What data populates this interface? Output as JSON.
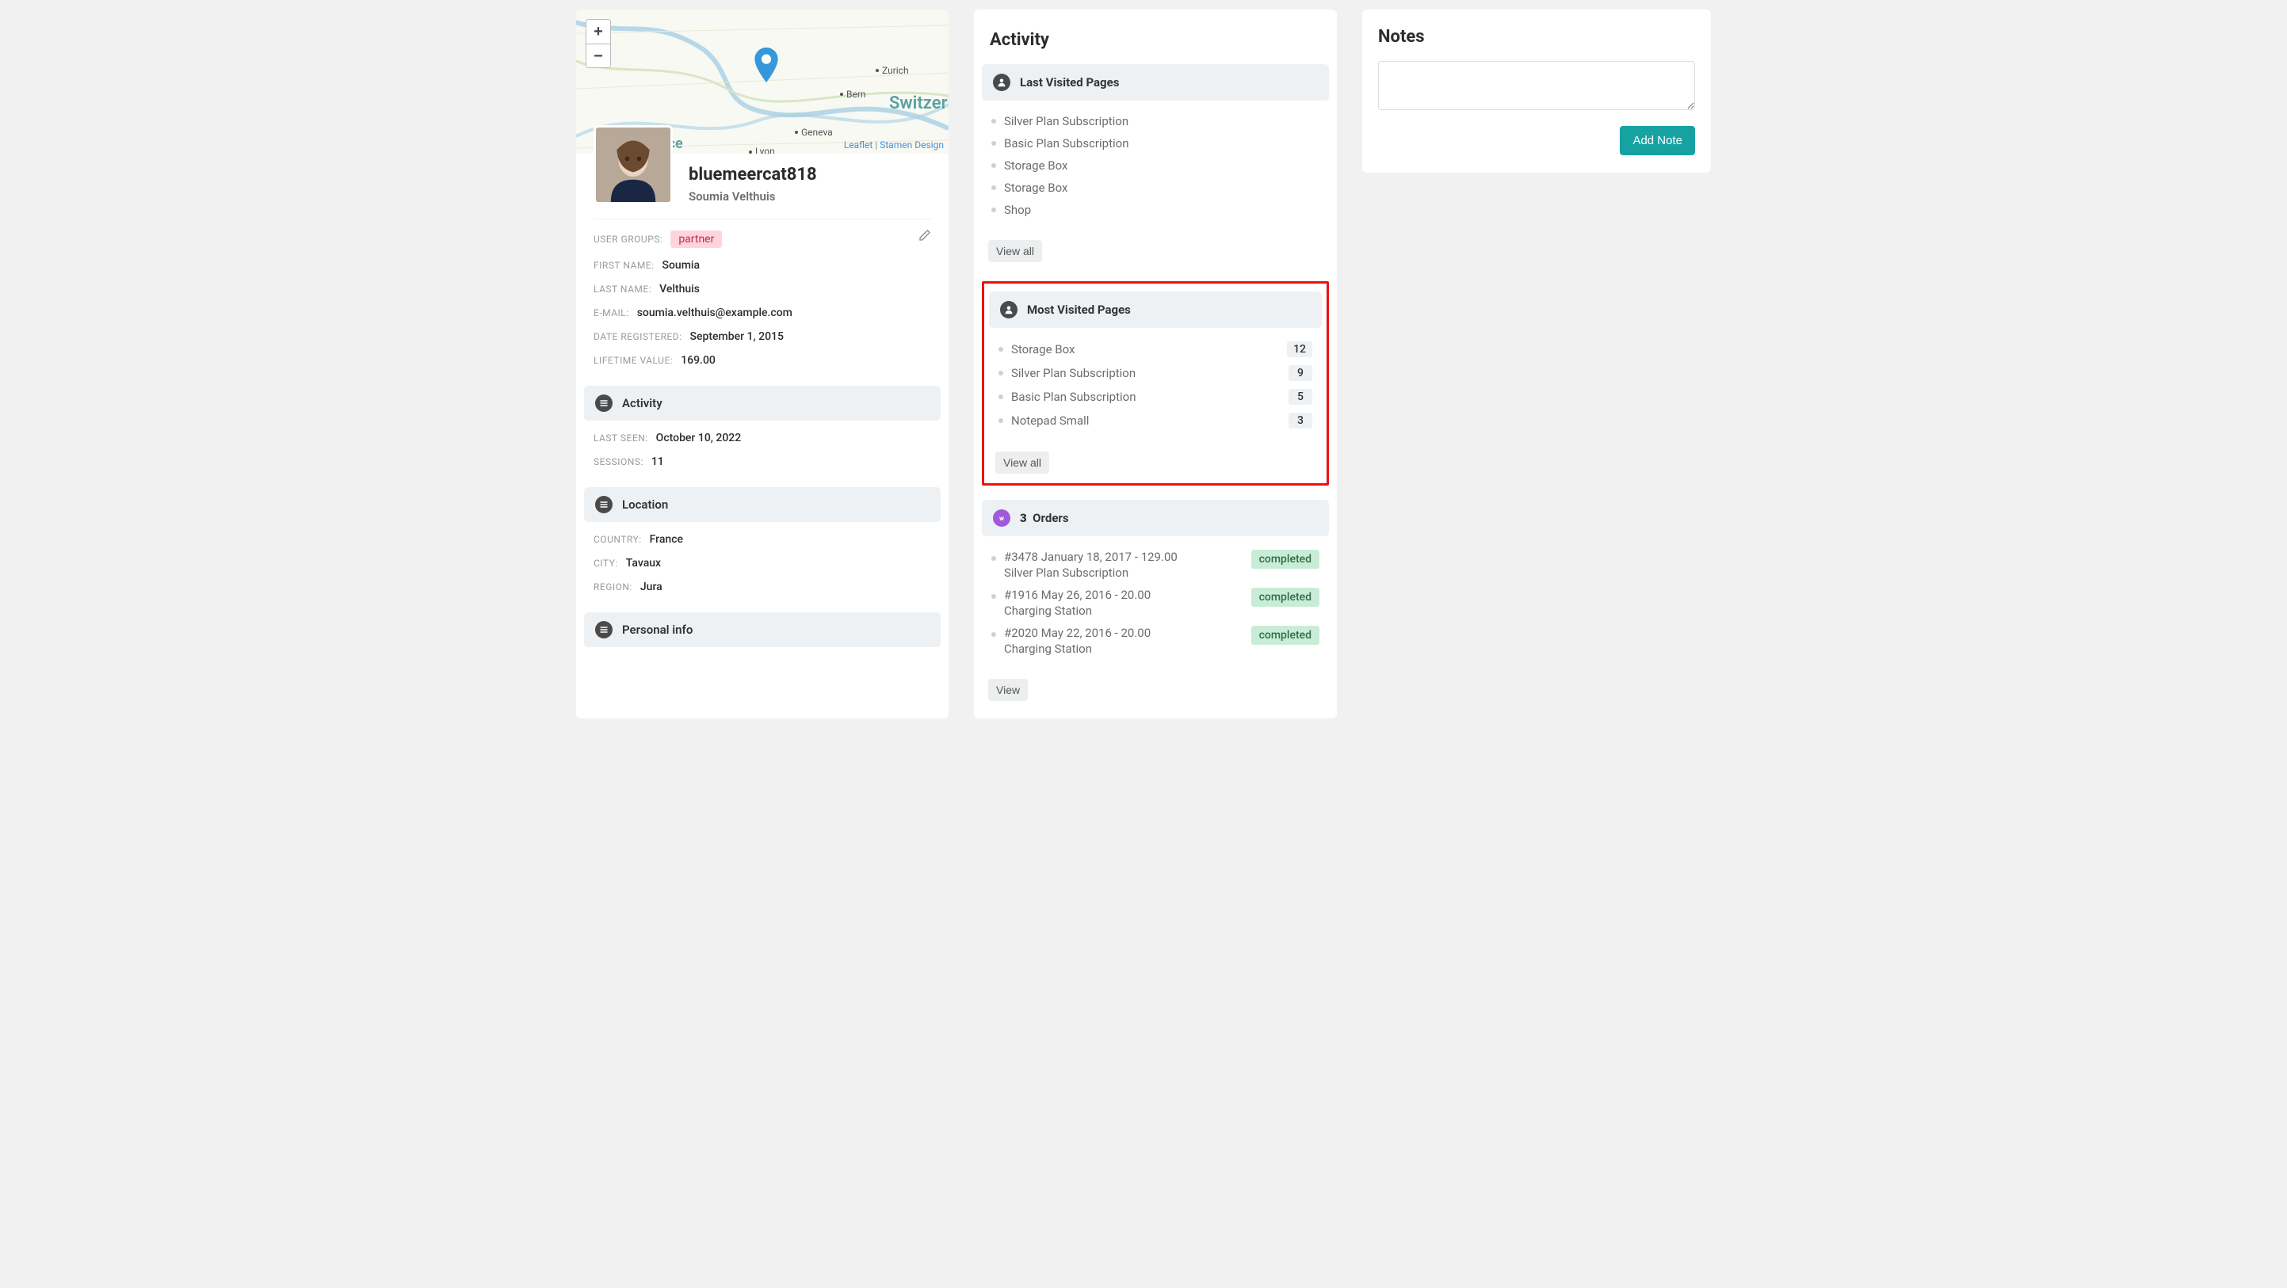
{
  "map": {
    "attrib_leaflet": "Leaflet",
    "attrib_sep": " | ",
    "attrib_stamen": "Stamen Design",
    "labels": {
      "country": "Switzerland",
      "zurich": "Zurich",
      "bern": "Bern",
      "geneva": "Geneva",
      "lyon": "Lyon",
      "france": "France"
    }
  },
  "user": {
    "username": "bluemeercat818",
    "fullname": "Soumia Velthuis",
    "groups_label": "USER GROUPS:",
    "group_badge": "partner",
    "first_label": "FIRST NAME:",
    "first": "Soumia",
    "last_label": "LAST NAME:",
    "last": "Velthuis",
    "email_label": "E-MAIL:",
    "email": "soumia.velthuis@example.com",
    "reg_label": "DATE REGISTERED:",
    "reg": "September 1, 2015",
    "ltv_label": "LIFETIME VALUE:",
    "ltv": "169.00"
  },
  "left_sections": {
    "activity": "Activity",
    "lastseen_label": "LAST SEEN:",
    "lastseen": "October 10, 2022",
    "sessions_label": "SESSIONS:",
    "sessions": "11",
    "location": "Location",
    "country_label": "COUNTRY:",
    "country": "France",
    "city_label": "CITY:",
    "city": "Tavaux",
    "region_label": "REGION:",
    "region": "Jura",
    "personal": "Personal info"
  },
  "activity": {
    "title": "Activity",
    "last_visited": {
      "header": "Last Visited Pages",
      "items": [
        "Silver Plan Subscription",
        "Basic Plan Subscription",
        "Storage Box",
        "Storage Box",
        "Shop"
      ],
      "view_all": "View all"
    },
    "most_visited": {
      "header": "Most Visited Pages",
      "items": [
        {
          "name": "Storage Box",
          "count": "12"
        },
        {
          "name": "Silver Plan Subscription",
          "count": "9"
        },
        {
          "name": "Basic Plan Subscription",
          "count": "5"
        },
        {
          "name": "Notepad Small",
          "count": "3"
        }
      ],
      "view_all": "View all"
    },
    "orders": {
      "count": "3",
      "label": "Orders",
      "items": [
        {
          "summary": "#3478 January 18, 2017 - 129.00",
          "product": "Silver Plan Subscription",
          "status": "completed"
        },
        {
          "summary": "#1916 May 26, 2016 - 20.00",
          "product": "Charging Station",
          "status": "completed"
        },
        {
          "summary": "#2020 May 22, 2016 - 20.00",
          "product": "Charging Station",
          "status": "completed"
        }
      ],
      "view": "View"
    }
  },
  "notes": {
    "title": "Notes",
    "add": "Add Note"
  }
}
